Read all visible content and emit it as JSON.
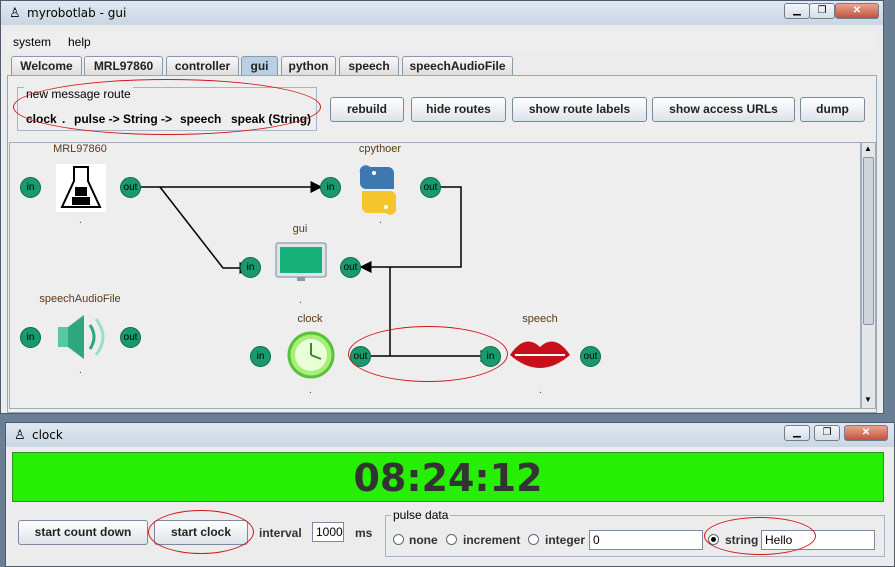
{
  "main_window": {
    "title": "myrobotlab - gui",
    "minimize": "▁",
    "restore": "❐",
    "close": "✕",
    "icon": "robot-icon"
  },
  "menu": [
    "system",
    "help"
  ],
  "tabs": [
    "Welcome",
    "MRL97860",
    "controller",
    "gui",
    "python",
    "speech",
    "speechAudioFile"
  ],
  "active_tab": "gui",
  "route": {
    "legend": "new message route",
    "source": "clock",
    "dot": ".",
    "method": "pulse -> String",
    "arrow": "->",
    "target": "speech",
    "target_method": "speak (String)"
  },
  "toolbar": {
    "rebuild": "rebuild",
    "hide_routes": "hide routes",
    "show_route_labels": "show route labels",
    "show_access_urls": "show access URLs",
    "dump": "dump"
  },
  "services": {
    "mrl": {
      "label": "MRL97860",
      "in": "in",
      "out": "out",
      "icon": "robot-flask-icon"
    },
    "controller": {
      "label": "cpythoer",
      "in": "in",
      "out": "out",
      "icon": "python-logo-icon"
    },
    "gui": {
      "label": "gui",
      "in": "in",
      "out": "out",
      "icon": "monitor-icon"
    },
    "speechAudioFile": {
      "label": "speechAudioFile",
      "in": "in",
      "out": "out",
      "icon": "speaker-icon"
    },
    "clock": {
      "label": "clock",
      "in": "in",
      "out": "out",
      "icon": "clock-icon"
    },
    "speech": {
      "label": "speech",
      "in": "in",
      "out": "out",
      "icon": "lips-icon"
    }
  },
  "clock_window": {
    "title": "clock",
    "time": "08:24:12",
    "start_count_down": "start count down",
    "start_clock": "start clock",
    "interval_label": "interval",
    "interval_value": "1000",
    "ms_label": "ms",
    "pulse_data_legend": "pulse data",
    "options": {
      "none": "none",
      "increment": "increment",
      "integer": "integer",
      "string": "string"
    },
    "integer_value": "0",
    "string_value": "Hello",
    "selected": "string"
  },
  "colors": {
    "port": "#1a9a6c",
    "clock_bg": "#26ee04",
    "annotation": "#d2161b"
  }
}
